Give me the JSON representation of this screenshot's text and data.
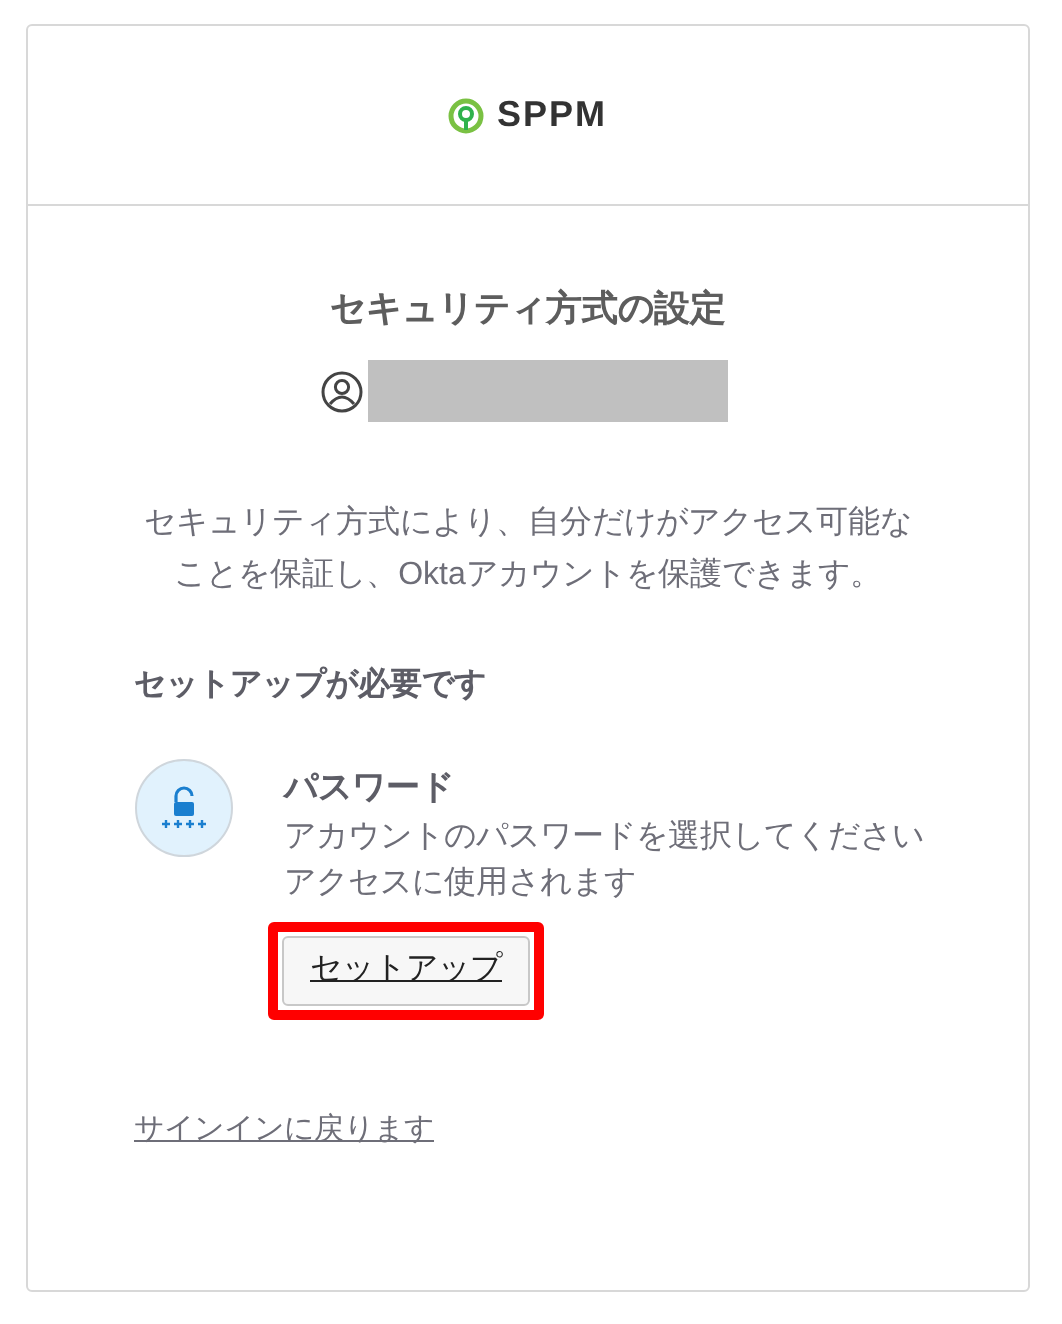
{
  "header": {
    "logo_text": "SPPM"
  },
  "title": "セキュリティ方式の設定",
  "description": "セキュリティ方式により、自分だけがアクセス可能なことを保証し、Oktaアカウントを保護できます。",
  "section_title": "セットアップが必要です",
  "authenticators": [
    {
      "kind": "password",
      "name": "パスワード",
      "description_lines": [
        "アカウントのパスワードを選択してください",
        "アクセスに使用されます"
      ],
      "button": "セットアップ",
      "highlighted": true
    }
  ],
  "back_link": "サインインに戻ります"
}
